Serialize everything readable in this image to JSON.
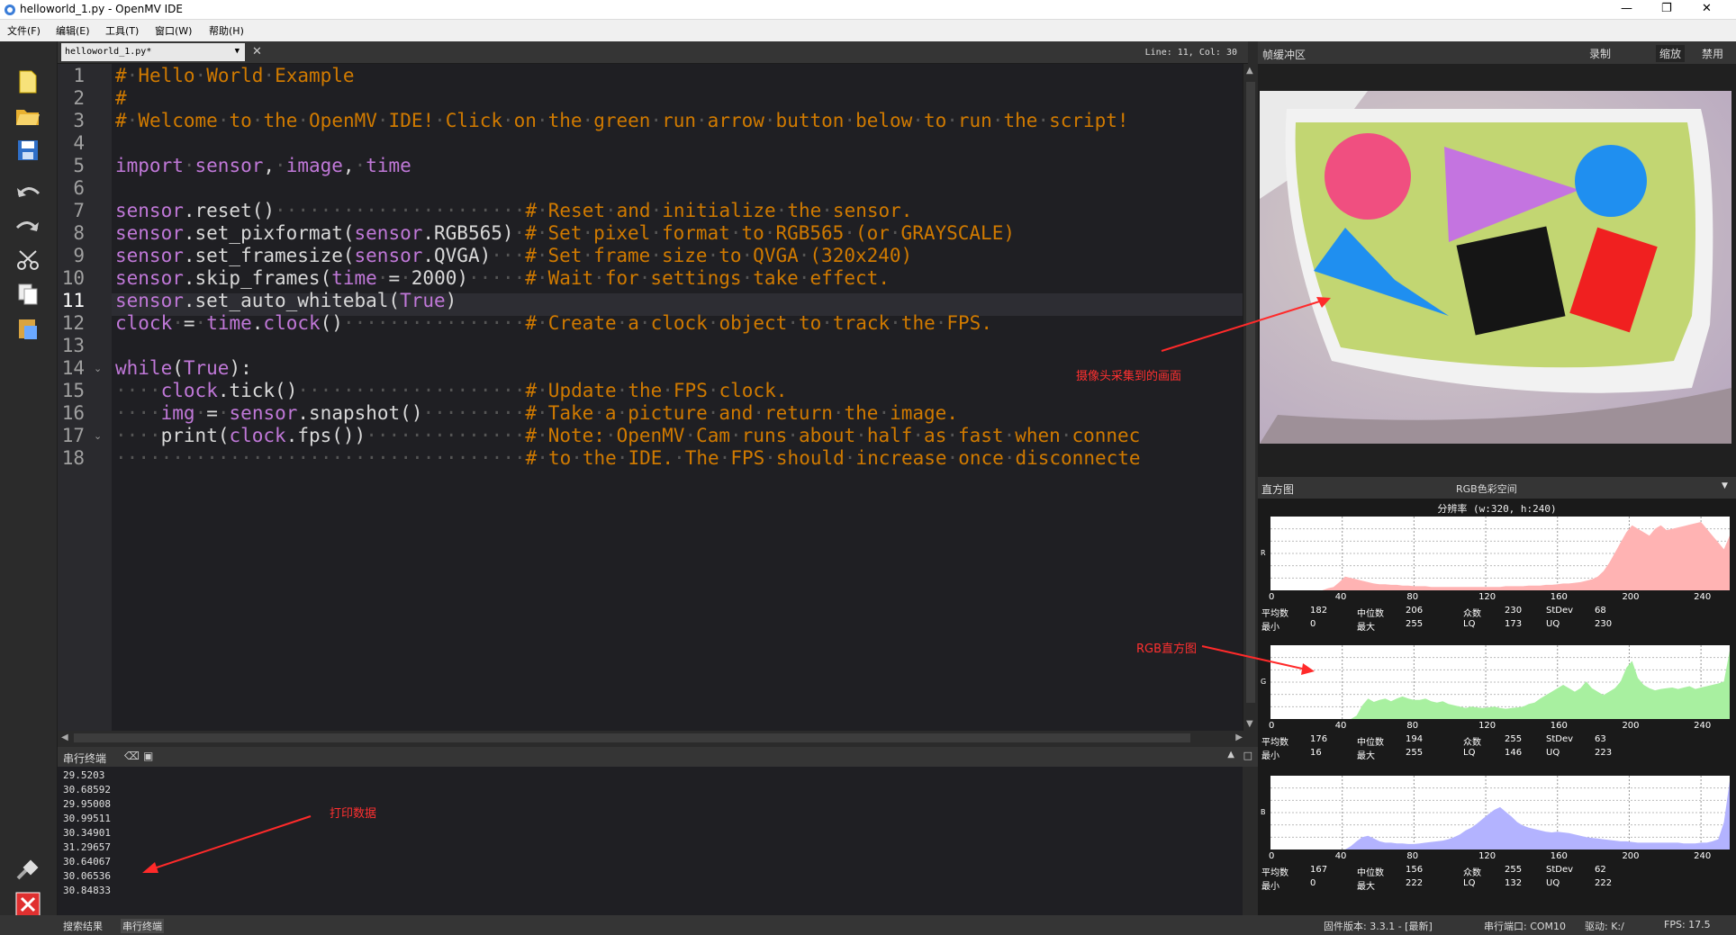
{
  "window": {
    "title": "helloworld_1.py - OpenMV IDE"
  },
  "menu": {
    "items": [
      "文件(F)",
      "编辑(E)",
      "工具(T)",
      "窗口(W)",
      "帮助(H)"
    ]
  },
  "editor": {
    "tab_name": "helloworld_1.py*",
    "line_col": "Line: 11, Col: 30",
    "current_line": 11,
    "line_numbers": [
      "1",
      "2",
      "3",
      "4",
      "5",
      "6",
      "7",
      "8",
      "9",
      "10",
      "11",
      "12",
      "13",
      "14",
      "15",
      "16",
      "17",
      "18"
    ]
  },
  "code": [
    "# Hello World Example",
    "#",
    "# Welcome to the OpenMV IDE! Click on the green run arrow button below to run the script!",
    "",
    "import sensor, image, time",
    "",
    "sensor.reset()                      # Reset and initialize the sensor.",
    "sensor.set_pixformat(sensor.RGB565) # Set pixel format to RGB565 (or GRAYSCALE)",
    "sensor.set_framesize(sensor.QVGA)   # Set frame size to QVGA (320x240)",
    "sensor.skip_frames(time = 2000)     # Wait for settings take effect.",
    "sensor.set_auto_whitebal(True)",
    "clock = time.clock()                # Create a clock object to track the FPS.",
    "",
    "while(True):",
    "    clock.tick()                    # Update the FPS clock.",
    "    img = sensor.snapshot()         # Take a picture and return the image.",
    "    print(clock.fps())              # Note: OpenMV Cam runs about half as fast when connec",
    "                                    # to the IDE. The FPS should increase once disconnecte"
  ],
  "terminal": {
    "title": "串行终端",
    "lines": [
      "29.5203",
      "30.68592",
      "29.95008",
      "30.99511",
      "30.34901",
      "31.29657",
      "30.64067",
      "30.06536",
      "30.84833"
    ]
  },
  "framebuffer": {
    "title": "帧缓冲区",
    "record": "录制",
    "zoom": "缩放",
    "disable": "禁用"
  },
  "histogram": {
    "title": "直方图",
    "colorspace": "RGB色彩空间",
    "resolution": "分辨率 (w:320, h:240)",
    "x_ticks": [
      "0",
      "40",
      "80",
      "120",
      "160",
      "200",
      "240"
    ],
    "stat_labels": {
      "mean": "平均数",
      "median": "中位数",
      "mode": "众数",
      "stdev": "StDev",
      "min": "最小",
      "max": "最大",
      "lq": "LQ",
      "uq": "UQ"
    },
    "channels": [
      {
        "name": "R",
        "color": "#ffb3b3",
        "mean": "182",
        "median": "206",
        "mode": "230",
        "stdev": "68",
        "min": "0",
        "max": "255",
        "lq": "173",
        "uq": "230",
        "values": [
          0,
          0,
          0,
          0,
          0,
          0,
          0,
          0,
          0,
          0,
          3,
          5,
          12,
          20,
          18,
          16,
          14,
          12,
          10,
          9,
          9,
          8,
          8,
          7,
          7,
          6,
          6,
          6,
          5,
          5,
          5,
          5,
          5,
          5,
          5,
          5,
          5,
          5,
          5,
          5,
          5,
          6,
          6,
          6,
          6,
          7,
          7,
          7,
          8,
          8,
          9,
          10,
          10,
          11,
          12,
          14,
          16,
          20,
          28,
          40,
          55,
          70,
          85,
          95,
          90,
          85,
          80,
          90,
          95,
          88,
          90,
          92,
          94,
          96,
          98,
          100,
          90,
          80,
          70,
          60,
          80
        ]
      },
      {
        "name": "G",
        "color": "#a8f0a0",
        "mean": "176",
        "median": "194",
        "mode": "255",
        "stdev": "63",
        "min": "16",
        "max": "255",
        "lq": "146",
        "uq": "223",
        "values": [
          0,
          0,
          0,
          0,
          0,
          0,
          0,
          0,
          0,
          0,
          0,
          0,
          0,
          0,
          0,
          5,
          20,
          30,
          25,
          28,
          30,
          26,
          30,
          33,
          30,
          28,
          28,
          30,
          26,
          24,
          26,
          22,
          20,
          18,
          16,
          18,
          17,
          16,
          17,
          18,
          16,
          15,
          16,
          17,
          18,
          22,
          24,
          30,
          35,
          40,
          45,
          50,
          45,
          40,
          45,
          55,
          45,
          40,
          35,
          40,
          45,
          55,
          75,
          85,
          60,
          50,
          45,
          42,
          44,
          45,
          46,
          44,
          46,
          48,
          44,
          46,
          48,
          50,
          52,
          55,
          100
        ]
      },
      {
        "name": "B",
        "color": "#b3b3ff",
        "mean": "167",
        "median": "156",
        "mode": "255",
        "stdev": "62",
        "min": "0",
        "max": "222",
        "lq": "132",
        "uq": "222",
        "values": [
          0,
          0,
          0,
          0,
          0,
          0,
          0,
          0,
          0,
          0,
          0,
          0,
          0,
          0,
          5,
          12,
          18,
          20,
          16,
          12,
          10,
          10,
          9,
          9,
          8,
          8,
          9,
          10,
          11,
          12,
          13,
          15,
          18,
          22,
          28,
          32,
          38,
          45,
          52,
          58,
          62,
          55,
          48,
          40,
          35,
          32,
          30,
          28,
          26,
          25,
          26,
          25,
          24,
          22,
          20,
          18,
          17,
          16,
          15,
          14,
          13,
          12,
          12,
          11,
          10,
          10,
          10,
          10,
          10,
          10,
          10,
          10,
          9,
          9,
          9,
          10,
          10,
          12,
          15,
          40,
          100
        ]
      }
    ]
  },
  "annotations": {
    "camera": "摄像头采集到的画面",
    "rgb": "RGB直方图",
    "print": "打印数据"
  },
  "status": {
    "tabs": [
      "搜索结果",
      "串行终端"
    ],
    "firmware": "固件版本: 3.3.1 - [最新]",
    "port": "串行端口: COM10",
    "drive": "驱动: K:/",
    "fps": "FPS: 17.5"
  }
}
